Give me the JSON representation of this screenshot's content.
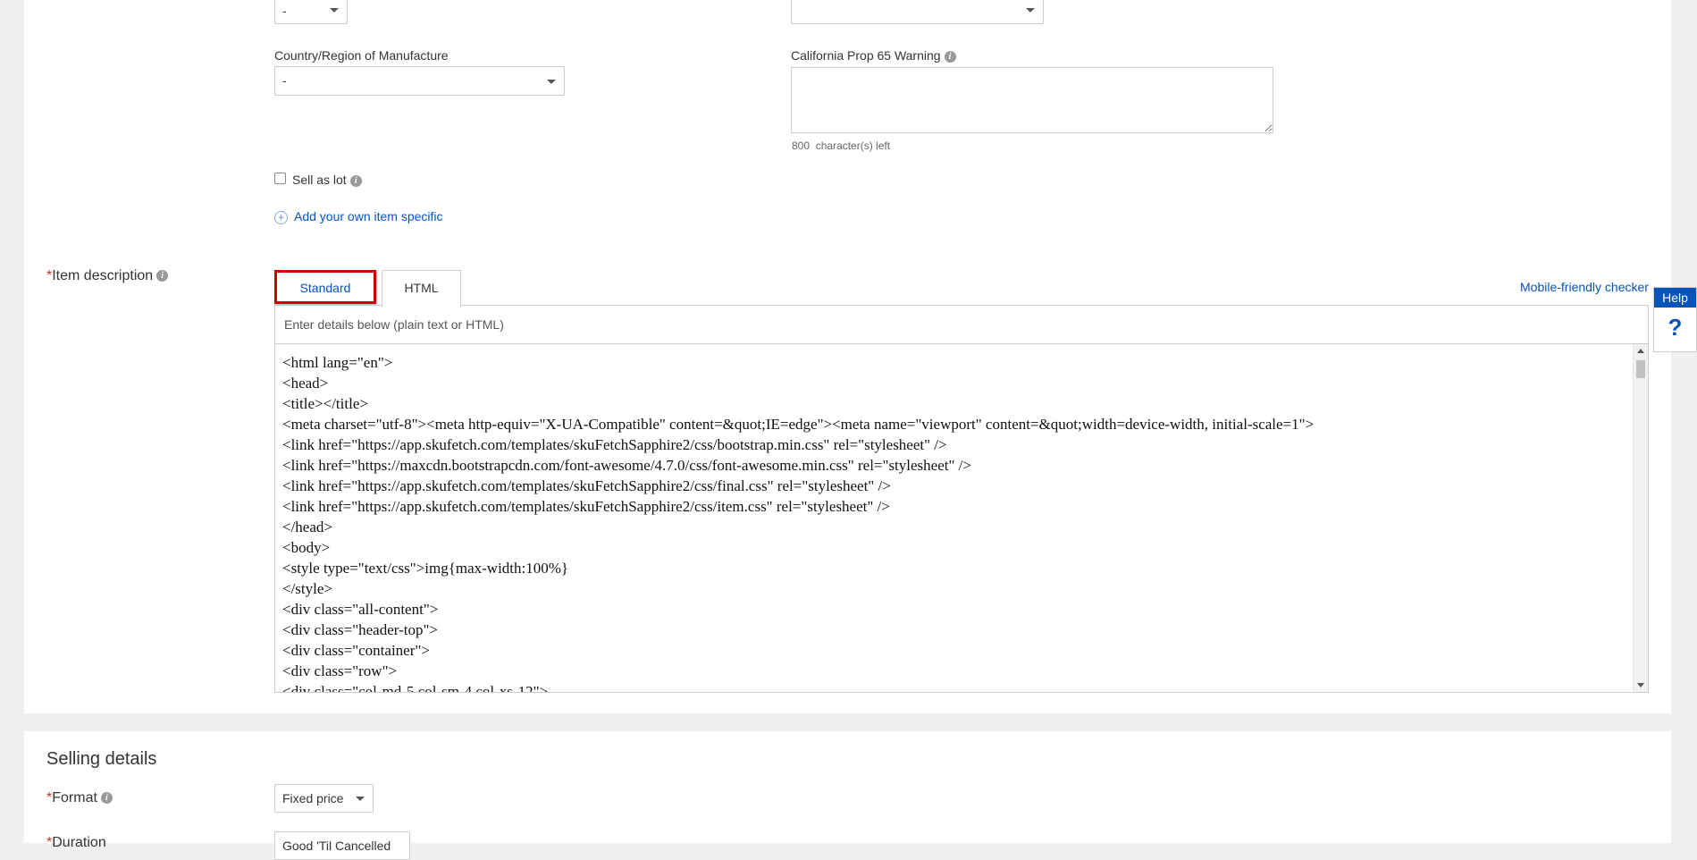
{
  "fields": {
    "top_left_select_value": "-",
    "top_right_select_value": "",
    "country_label": "Country/Region of Manufacture",
    "country_value": "-",
    "prop65_label": "California Prop 65 Warning",
    "prop65_value": "",
    "chars_left_count": "800",
    "chars_left_text": "character(s) left",
    "sell_as_lot_label": "Sell as lot",
    "add_specific_label": "Add your own item specific"
  },
  "description": {
    "required_mark": "*",
    "label": "Item description",
    "tabs": [
      {
        "label": "Standard"
      },
      {
        "label": "HTML"
      }
    ],
    "mobile_checker": "Mobile-friendly checker",
    "hint": "Enter details below (plain text or HTML)",
    "code_lines": [
      "<html lang=\"en\">",
      "<head>",
      "<title></title>",
      "<meta charset=\"utf-8\"><meta http-equiv=\"X-UA-Compatible\" content=&quot;IE=edge\"><meta name=\"viewport\" content=&quot;width=device-width, initial-scale=1\">",
      "<link href=\"https://app.skufetch.com/templates/skuFetchSapphire2/css/bootstrap.min.css\" rel=\"stylesheet\" />",
      "<link href=\"https://maxcdn.bootstrapcdn.com/font-awesome/4.7.0/css/font-awesome.min.css\" rel=\"stylesheet\" />",
      "<link href=\"https://app.skufetch.com/templates/skuFetchSapphire2/css/final.css\" rel=\"stylesheet\" />",
      "<link href=\"https://app.skufetch.com/templates/skuFetchSapphire2/css/item.css\" rel=\"stylesheet\" />",
      "</head>",
      "<body>",
      "<style type=\"text/css\">img{max-width:100%}",
      "</style>",
      "<div class=\"all-content\">",
      "<div class=\"header-top\">",
      "<div class=\"container\">",
      "<div class=\"row\">",
      "<div class=\"col-md-5 col-sm-4 col-xs-12\">"
    ]
  },
  "help": {
    "label": "Help",
    "icon_glyph": "?"
  },
  "selling": {
    "section_title": "Selling details",
    "format_required_mark": "*",
    "format_label": "Format",
    "format_value": "Fixed price",
    "duration_required_mark": "*",
    "duration_label": "Duration",
    "duration_value": "Good 'Til Cancelled"
  },
  "colors": {
    "accent": "#0654ba",
    "highlight_border": "#cc0000",
    "required": "#c0392b",
    "help_bg": "#0654ba"
  }
}
